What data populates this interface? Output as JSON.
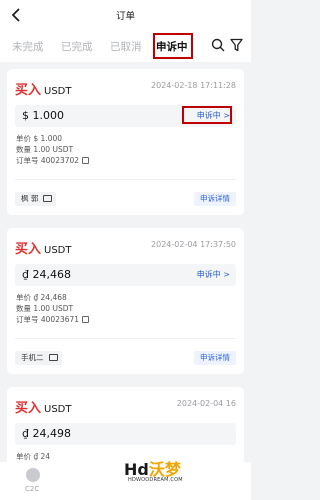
{
  "header": {
    "title": "订单",
    "back_icon": "chevron-left-icon"
  },
  "tabs": [
    {
      "label": "未完成",
      "active": false
    },
    {
      "label": "已完成",
      "active": false
    },
    {
      "label": "已取消",
      "active": false
    },
    {
      "label": "申诉中",
      "active": true
    }
  ],
  "toolbar_icons": [
    "search-icon",
    "filter-icon"
  ],
  "orders": [
    {
      "side": "买入",
      "coin": "USDT",
      "time": "2024-02-18 17:11:28",
      "amount": "$ 1.000",
      "status": "申诉中",
      "unit_price": "单价 $ 1.000",
      "quantity": "数量 1.00 USDT",
      "order_no": "订单号 40023702",
      "user": "枫 郭",
      "detail_label": "申诉详情"
    },
    {
      "side": "买入",
      "coin": "USDT",
      "time": "2024-02-04 17:37:50",
      "amount": "₫ 24,468",
      "status": "申诉中",
      "unit_price": "单价 ₫ 24,468",
      "quantity": "数量 1.00 USDT",
      "order_no": "订单号 40023671",
      "user": "手机二",
      "detail_label": "申诉详情"
    },
    {
      "side": "买入",
      "coin": "USDT",
      "time": "2024-02-04 16",
      "amount": "₫ 24,498",
      "unit_price": "单价 ₫ 24"
    }
  ],
  "bottom_nav": {
    "label": "C2C"
  },
  "watermark": {
    "main_a": "Hd",
    "main_b": "沃梦",
    "sub": "HDWOODREAM.COM"
  },
  "colors": {
    "buy": "#e0302e",
    "link": "#2b5fd9",
    "highlight_box": "#c00000"
  }
}
